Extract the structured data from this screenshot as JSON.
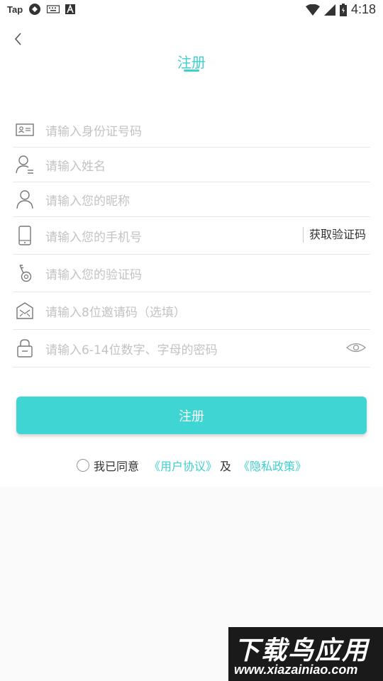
{
  "status_bar": {
    "left_app_label": "Tap",
    "time": "4:18",
    "icons": [
      "sync-icon",
      "keyboard-icon",
      "a-icon",
      "wifi-icon",
      "signal-icon",
      "battery-icon"
    ]
  },
  "header": {
    "back_icon": "chevron-left-icon",
    "title": "注册"
  },
  "form": {
    "fields": [
      {
        "icon": "id-card-icon",
        "placeholder": "请输入身份证号码"
      },
      {
        "icon": "user-name-icon",
        "placeholder": "请输入姓名"
      },
      {
        "icon": "user-icon",
        "placeholder": "请输入您的昵称"
      },
      {
        "icon": "phone-icon",
        "placeholder": "请输入您的手机号",
        "action": "获取验证码"
      },
      {
        "icon": "key-icon",
        "placeholder": "请输入您的验证码"
      },
      {
        "icon": "invite-icon",
        "placeholder": "请输入8位邀请码（选填）"
      },
      {
        "icon": "lock-icon",
        "placeholder": "请输入6-14位数字、字母的密码",
        "toggle_icon": "eye-icon"
      }
    ]
  },
  "submit": {
    "label": "注册"
  },
  "agreement": {
    "prefix": "我已同意",
    "user_agreement": "《用户协议》",
    "and": "及",
    "privacy_policy": "《隐私政策》"
  },
  "watermark": {
    "title": "下载鸟应用",
    "url": "www.xiazainiao.com"
  },
  "colors": {
    "accent": "#3fcfcf",
    "button": "#3fd5d2",
    "placeholder": "#c3c3c3"
  }
}
